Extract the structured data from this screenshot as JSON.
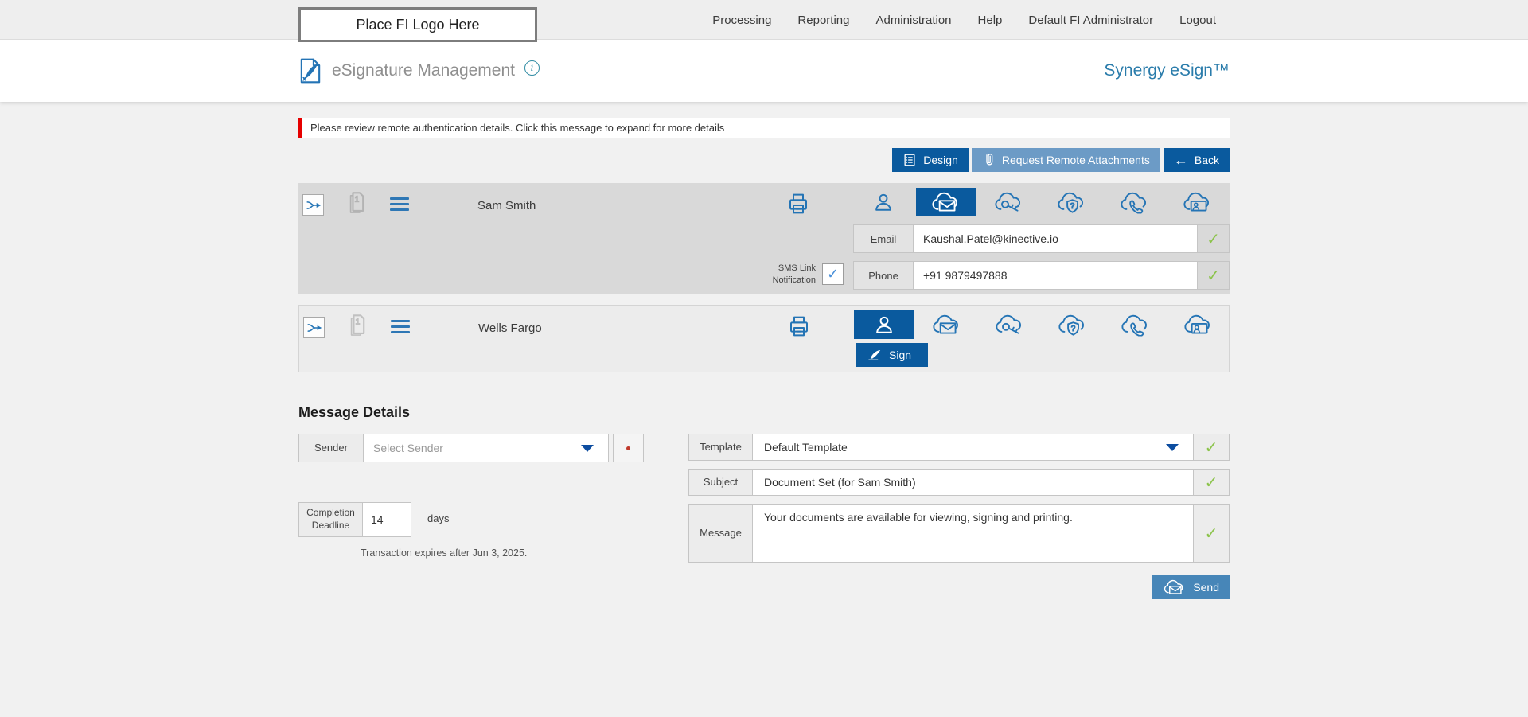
{
  "topnav": {
    "logo_label": "Place FI Logo Here",
    "items": [
      "Processing",
      "Reporting",
      "Administration",
      "Help",
      "Default FI Administrator",
      "Logout"
    ]
  },
  "header": {
    "title": "eSignature Management",
    "info_glyph": "i",
    "brand": "Synergy eSign™"
  },
  "alert": {
    "text": "Please review remote authentication details. Click this message to expand for more details"
  },
  "toolbar": {
    "design": "Design",
    "request_remote_attachments": "Request Remote Attachments",
    "back": "Back",
    "back_arrow": "←"
  },
  "recipients": [
    {
      "name": "Sam Smith",
      "selected_method": "remote-email",
      "email_label": "Email",
      "email_value": "Kaushal.Patel@kinective.io",
      "sms_label_line1": "SMS Link",
      "sms_label_line2": "Notification",
      "sms_checked": "✓",
      "phone_label": "Phone",
      "phone_value": "+91 9879497888"
    },
    {
      "name": "Wells Fargo",
      "selected_method": "in-person",
      "sign_label": "Sign"
    }
  ],
  "message_details": {
    "heading": "Message Details",
    "sender_label": "Sender",
    "sender_placeholder": "Select Sender",
    "deadline_label_line1": "Completion",
    "deadline_label_line2": "Deadline",
    "deadline_value": "14",
    "days_label": "days",
    "expiry_note": "Transaction expires after Jun 3, 2025.",
    "template_label": "Template",
    "template_value": "Default Template",
    "subject_label": "Subject",
    "subject_value": "Document Set (for Sam Smith)",
    "message_label": "Message",
    "message_value": "Your documents are available for viewing, signing and printing.",
    "send_label": "Send"
  },
  "icons": {
    "check": "✓"
  },
  "colors": {
    "accent_dark_blue": "#0a5a9e",
    "accent_medium_blue": "#6c9bc6",
    "send_blue": "#4786b8",
    "icon_blue": "#2474b5",
    "check_green": "#8bc34a",
    "alert_red": "#e60000",
    "brand_blue": "#2a7cab"
  }
}
